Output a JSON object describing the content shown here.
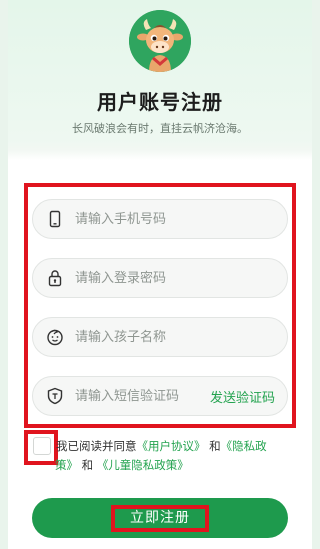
{
  "header": {
    "logo_icon": "cartoon-ox-mascot-icon",
    "title": "用户账号注册",
    "subtitle": "长风破浪会有时，直挂云帆济沧海。"
  },
  "form": {
    "phone": {
      "placeholder": "请输入手机号码",
      "value": "",
      "icon": "phone-icon"
    },
    "password": {
      "placeholder": "请输入登录密码",
      "value": "",
      "icon": "lock-icon"
    },
    "child_name": {
      "placeholder": "请输入孩子名称",
      "value": "",
      "icon": "child-face-icon"
    },
    "sms_code": {
      "placeholder": "请输入短信验证码",
      "value": "",
      "icon": "shield-icon",
      "send_label": "发送验证码"
    }
  },
  "agreement": {
    "checked": false,
    "prefix": "我已阅读并同意",
    "user_agreement": "《用户协议》",
    "and1": "和",
    "privacy_part1": "《隐私政",
    "privacy_part2": "策》",
    "and2": "和",
    "child_privacy": "《儿童隐私政策》"
  },
  "submit": {
    "label": "立即注册"
  },
  "colors": {
    "brand_green": "#1e9a4d",
    "link_green": "#23a34f",
    "highlight_red": "#e0141e"
  }
}
